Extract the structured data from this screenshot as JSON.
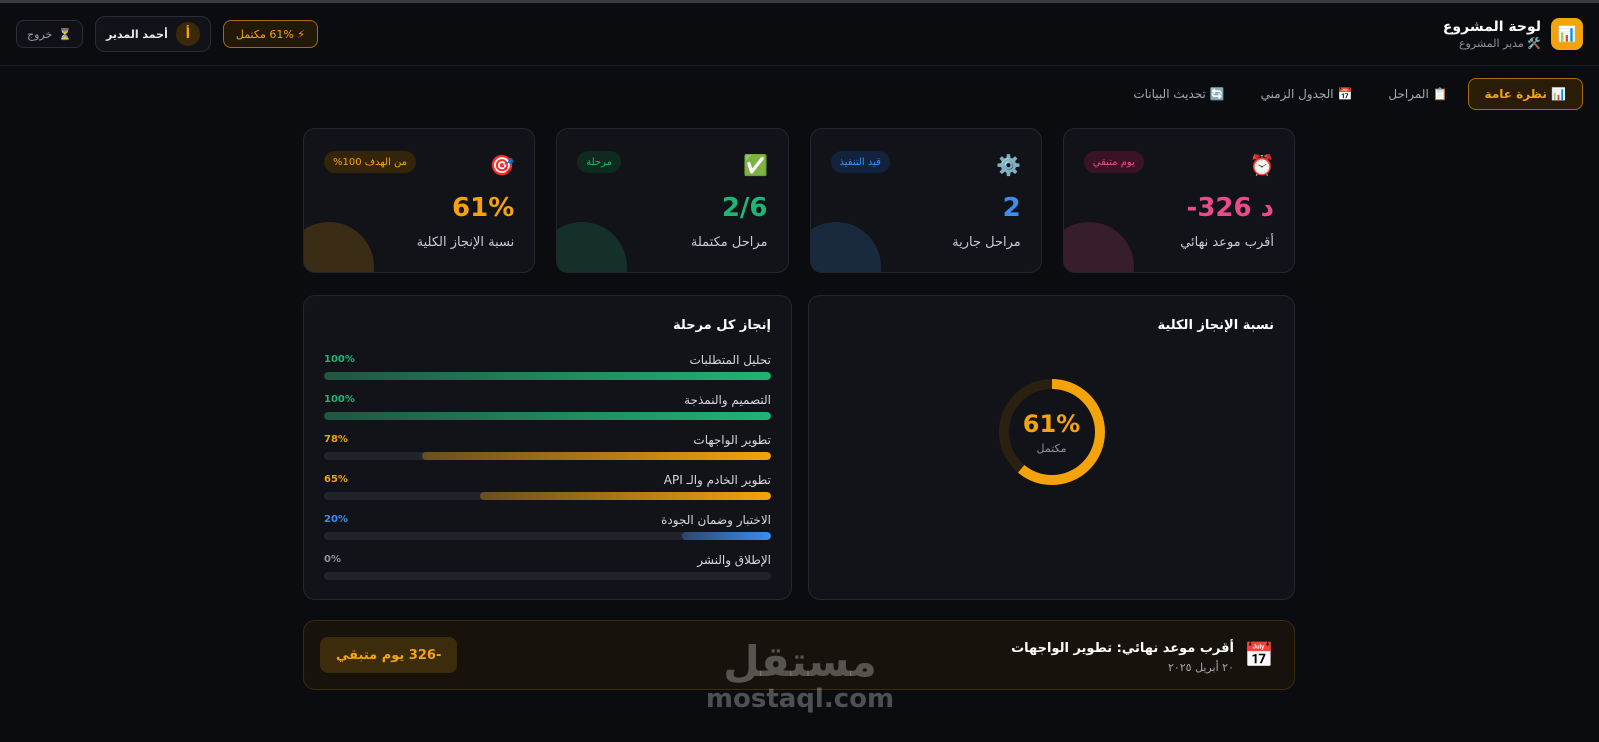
{
  "header": {
    "title": "لوحة المشروع",
    "subtitle": "🛠️ مدير المشروع",
    "logo_glyph": "📊",
    "progress_chip": "⚡ 61% مكتمل",
    "user_name": "أحمد المدير",
    "user_initial": "أ",
    "logout_label": "خروج",
    "logout_icon": "⏳"
  },
  "tabs": [
    {
      "label": "📊 نظرة عامة",
      "active": true
    },
    {
      "label": "📋 المراحل",
      "active": false
    },
    {
      "label": "📅 الجدول الزمني",
      "active": false
    },
    {
      "label": "🔄 تحديث البيانات",
      "active": false
    }
  ],
  "stats": [
    {
      "icon": "🎯",
      "badge": "من الهدف 100%",
      "value": "61%",
      "label": "نسبة الإنجاز الكلية",
      "color": "#f5a30b"
    },
    {
      "icon": "✅",
      "badge": "مرحلة",
      "value": "2/6",
      "label": "مراحل مكتملة",
      "color": "#20b574"
    },
    {
      "icon": "⚙️",
      "badge": "قيد التنفيذ",
      "value": "2",
      "label": "مراحل جارية",
      "color": "#3d8ef0"
    },
    {
      "icon": "⏰",
      "badge": "يوم متبقي",
      "value": "-326 د",
      "label": "أقرب موعد نهائي",
      "color": "#ea4c89"
    }
  ],
  "overall": {
    "title": "نسبة الإنجاز الكلية",
    "value": "61%",
    "fraction": 0.61,
    "label": "مكتمل"
  },
  "phases": {
    "title": "إنجاز كل مرحلة",
    "items": [
      {
        "name": "تحليل المتطلبات",
        "pct": "100%",
        "value": 1.0,
        "color": "#20b574"
      },
      {
        "name": "التصميم والنمذجة",
        "pct": "100%",
        "value": 1.0,
        "color": "#20b574"
      },
      {
        "name": "تطوير الواجهات",
        "pct": "78%",
        "value": 0.78,
        "color": "#f5a30b"
      },
      {
        "name": "تطوير الخادم والـ API",
        "pct": "65%",
        "value": 0.65,
        "color": "#f5a30b"
      },
      {
        "name": "الاختبار وضمان الجودة",
        "pct": "20%",
        "value": 0.2,
        "color": "#3d8ef0"
      },
      {
        "name": "الإطلاق والنشر",
        "pct": "0%",
        "value": 0.0,
        "color": "#8e929c"
      }
    ]
  },
  "deadline": {
    "icon": "📅",
    "title": "أقرب موعد نهائي: تطوير الواجهات",
    "date": "٢٠ أبريل ٢٠٢٥",
    "remaining": "-326 يوم متبقي"
  },
  "watermark": {
    "arabic": "مستقل",
    "latin": "mostaql.com"
  }
}
